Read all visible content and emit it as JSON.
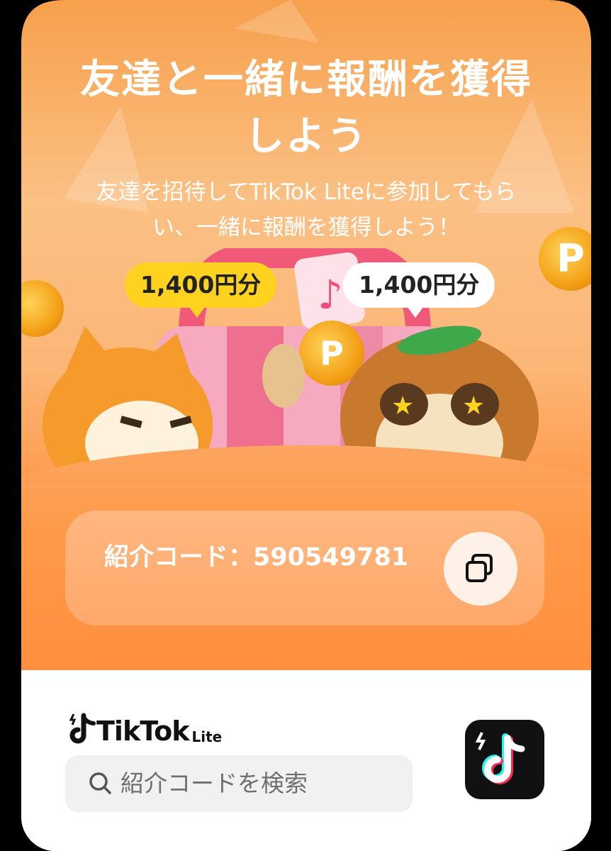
{
  "title": {
    "line1": "友達と一緒に報酬を獲得",
    "line2": "しよう"
  },
  "subtitle": {
    "line1": "友達を招待してTikTok Liteに参加してもら",
    "line2": "い、一緒に報酬を獲得しよう！"
  },
  "rewards": {
    "inviter": "1,400円分",
    "invitee": "1,400円分"
  },
  "referral": {
    "label": "紹介コード：590549781"
  },
  "brand": {
    "name": "TikTok",
    "suffix": "Lite"
  },
  "search": {
    "placeholder": "紹介コードを検索"
  },
  "colors": {
    "accent_orange": "#ff8a39",
    "badge_yellow": "#ffd21f",
    "white": "#ffffff"
  },
  "icons": [
    "tiktok-logo-icon",
    "copy-icon",
    "search-icon",
    "tiktok-app-icon",
    "coin-p-icon"
  ]
}
